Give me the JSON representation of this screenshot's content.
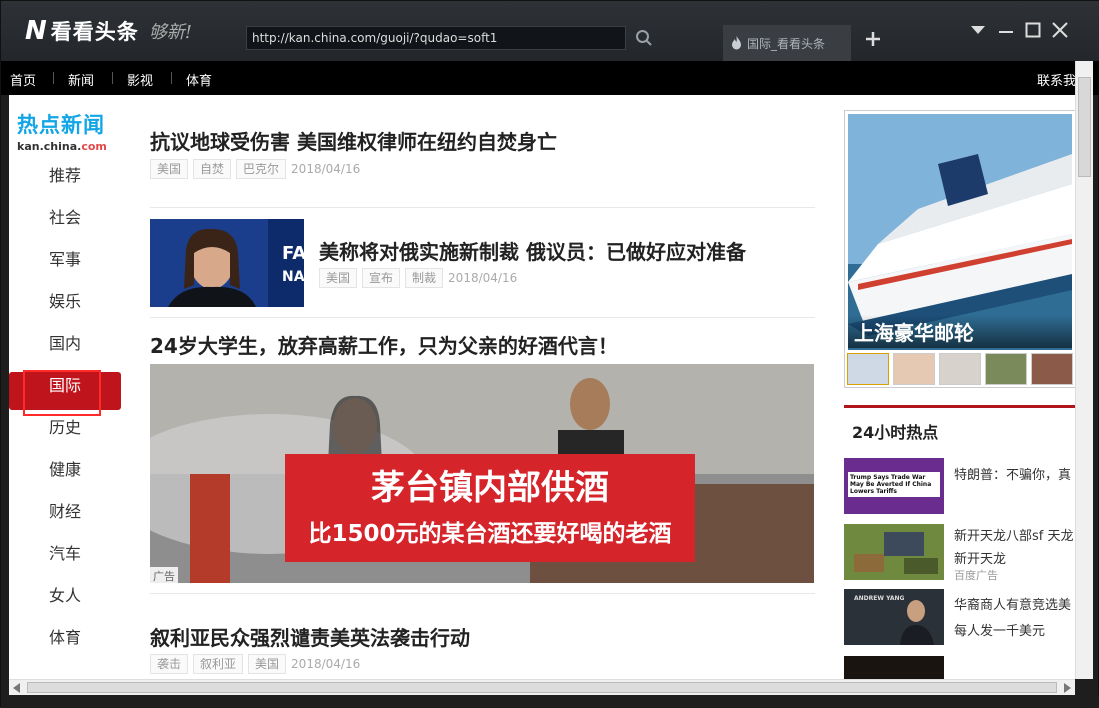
{
  "window": {
    "logo_letter": "N",
    "app_name": "看看头条",
    "slogan": "够新!",
    "address": "http://kan.china.com/guoji/?qudao=soft1",
    "tab_title": "国际_看看头条"
  },
  "nav": {
    "items": [
      "首页",
      "新闻",
      "影视",
      "体育"
    ],
    "right": "联系我"
  },
  "brand": {
    "title": "热点新闻",
    "domain_main": "kan.china.",
    "domain_com": "com"
  },
  "categories": [
    {
      "label": "推荐"
    },
    {
      "label": "社会"
    },
    {
      "label": "军事"
    },
    {
      "label": "娱乐"
    },
    {
      "label": "国内"
    },
    {
      "label": "国际"
    },
    {
      "label": "历史"
    },
    {
      "label": "健康"
    },
    {
      "label": "财经"
    },
    {
      "label": "汽车"
    },
    {
      "label": "女人"
    },
    {
      "label": "体育"
    }
  ],
  "active_category": "国际",
  "articles": [
    {
      "title": "抗议地球受伤害 美国维权律师在纽约自焚身亡",
      "tags": [
        "美国",
        "自焚",
        "巴克尔"
      ],
      "date": "2018/04/16"
    },
    {
      "title": "美称将对俄实施新制裁 俄议员：已做好应对准备",
      "tags": [
        "美国",
        "宣布",
        "制裁"
      ],
      "date": "2018/04/16"
    },
    {
      "title": "24岁大学生，放弃高薪工作，只为父亲的好酒代言！",
      "banner_line1": "茅台镇内部供酒",
      "banner_line2": "比1500元的某台酒还要好喝的老酒",
      "ad_label": "广告"
    },
    {
      "title": "叙利亚民众强烈谴责美英法袭击行动",
      "tags": [
        "袭击",
        "叙利亚",
        "美国"
      ],
      "date": "2018/04/16"
    }
  ],
  "side_ad": {
    "caption": "上海豪华邮轮"
  },
  "hot": {
    "title": "24小时热点",
    "items": [
      {
        "text": "特朗普：不骗你，真",
        "img_text": "Trump Says Trade War May Be Averted If China Lowers Tariffs"
      },
      {
        "text": "新开天龙八部sf 天龙",
        "text2": "新开天龙",
        "sub": "百度广告"
      },
      {
        "text": "华裔商人有意竞选美",
        "text2": "每人发一千美元",
        "img_text": "ANDREW YANG"
      }
    ]
  },
  "colors": {
    "accent": "#c0141c",
    "brand_blue": "#12a6e6"
  }
}
